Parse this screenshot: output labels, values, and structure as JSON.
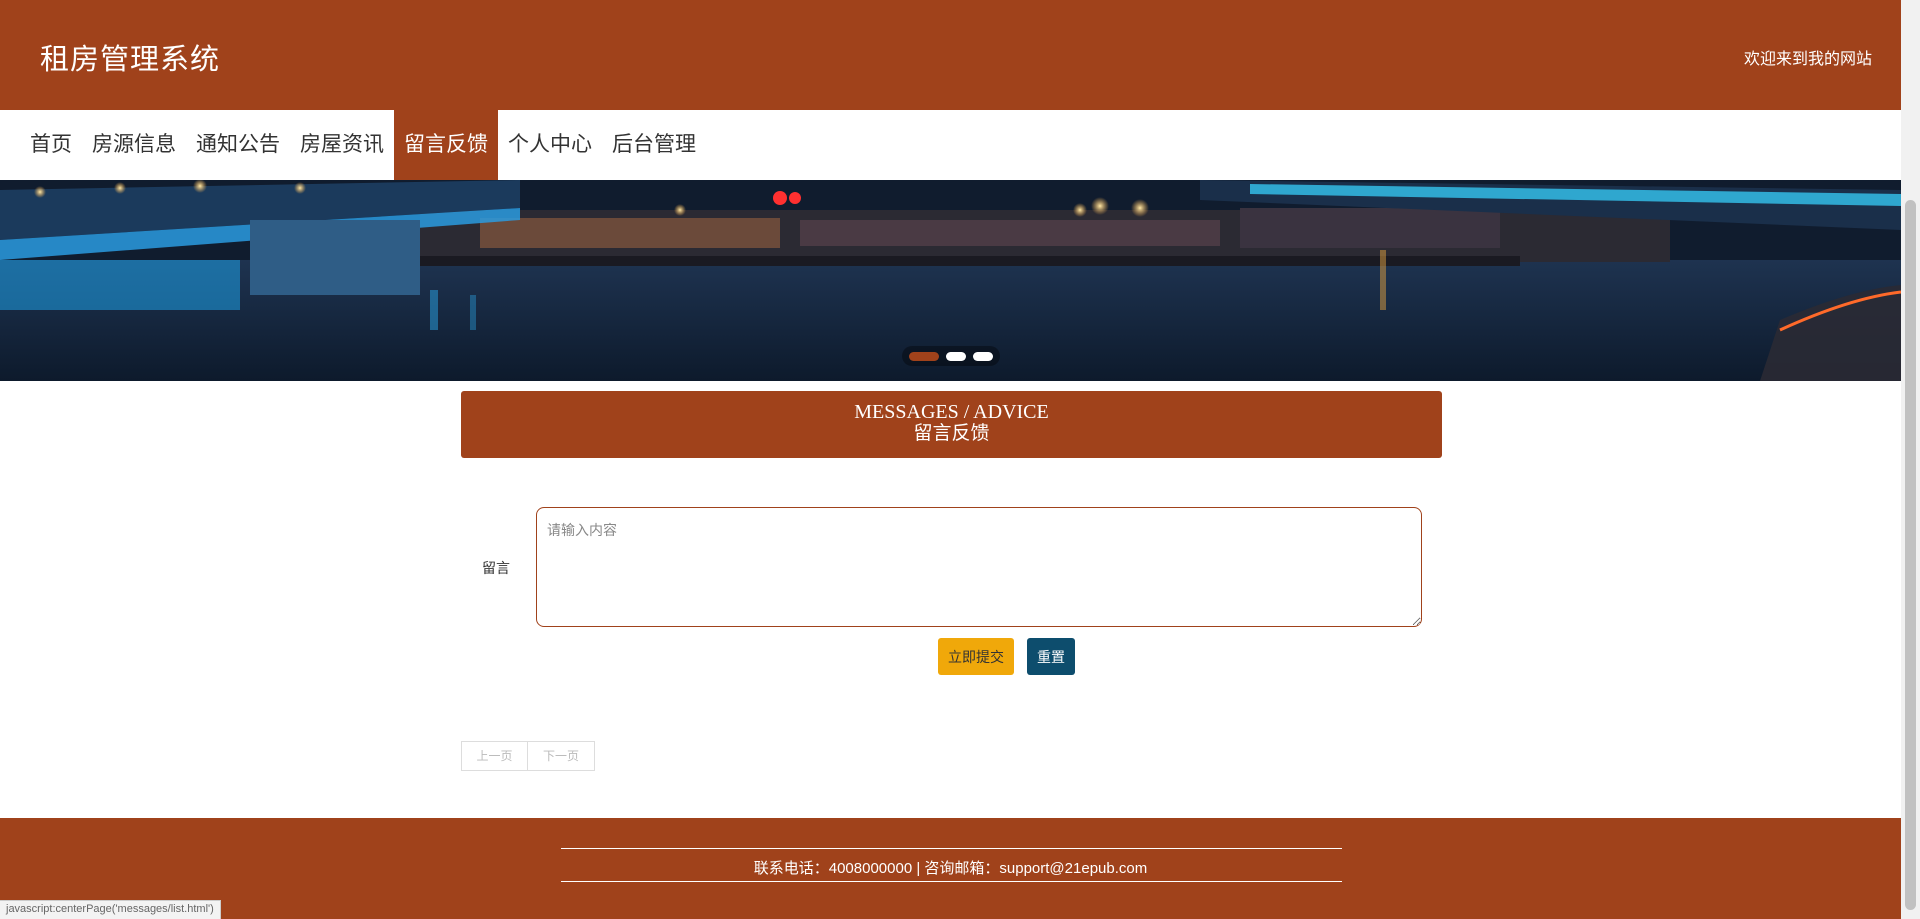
{
  "header": {
    "site_title": "租房管理系统",
    "welcome_text": "欢迎来到我的网站"
  },
  "nav": {
    "items": [
      {
        "label": "首页"
      },
      {
        "label": "房源信息"
      },
      {
        "label": "通知公告"
      },
      {
        "label": "房屋资讯"
      },
      {
        "label": "留言反馈",
        "active": true
      },
      {
        "label": "个人中心"
      },
      {
        "label": "后台管理"
      }
    ]
  },
  "banner": {
    "slide_count": 3,
    "active_slide": 1
  },
  "section": {
    "title_en": "MESSAGES / ADVICE",
    "title_zh": "留言反馈"
  },
  "form": {
    "message_label": "留言",
    "message_placeholder": "请输入内容",
    "message_value": "",
    "submit_label": "立即提交",
    "reset_label": "重置"
  },
  "pagination": {
    "prev_label": "上一页",
    "next_label": "下一页"
  },
  "footer": {
    "contact_text": "联系电话：4008000000 | 咨询邮箱：support@21epub.com"
  },
  "status_bar": {
    "url_text": "javascript:centerPage('messages/list.html')"
  },
  "colors": {
    "brand": "#a0421b",
    "submit_button": "#f0a80a",
    "reset_button": "#0d4d6d"
  }
}
